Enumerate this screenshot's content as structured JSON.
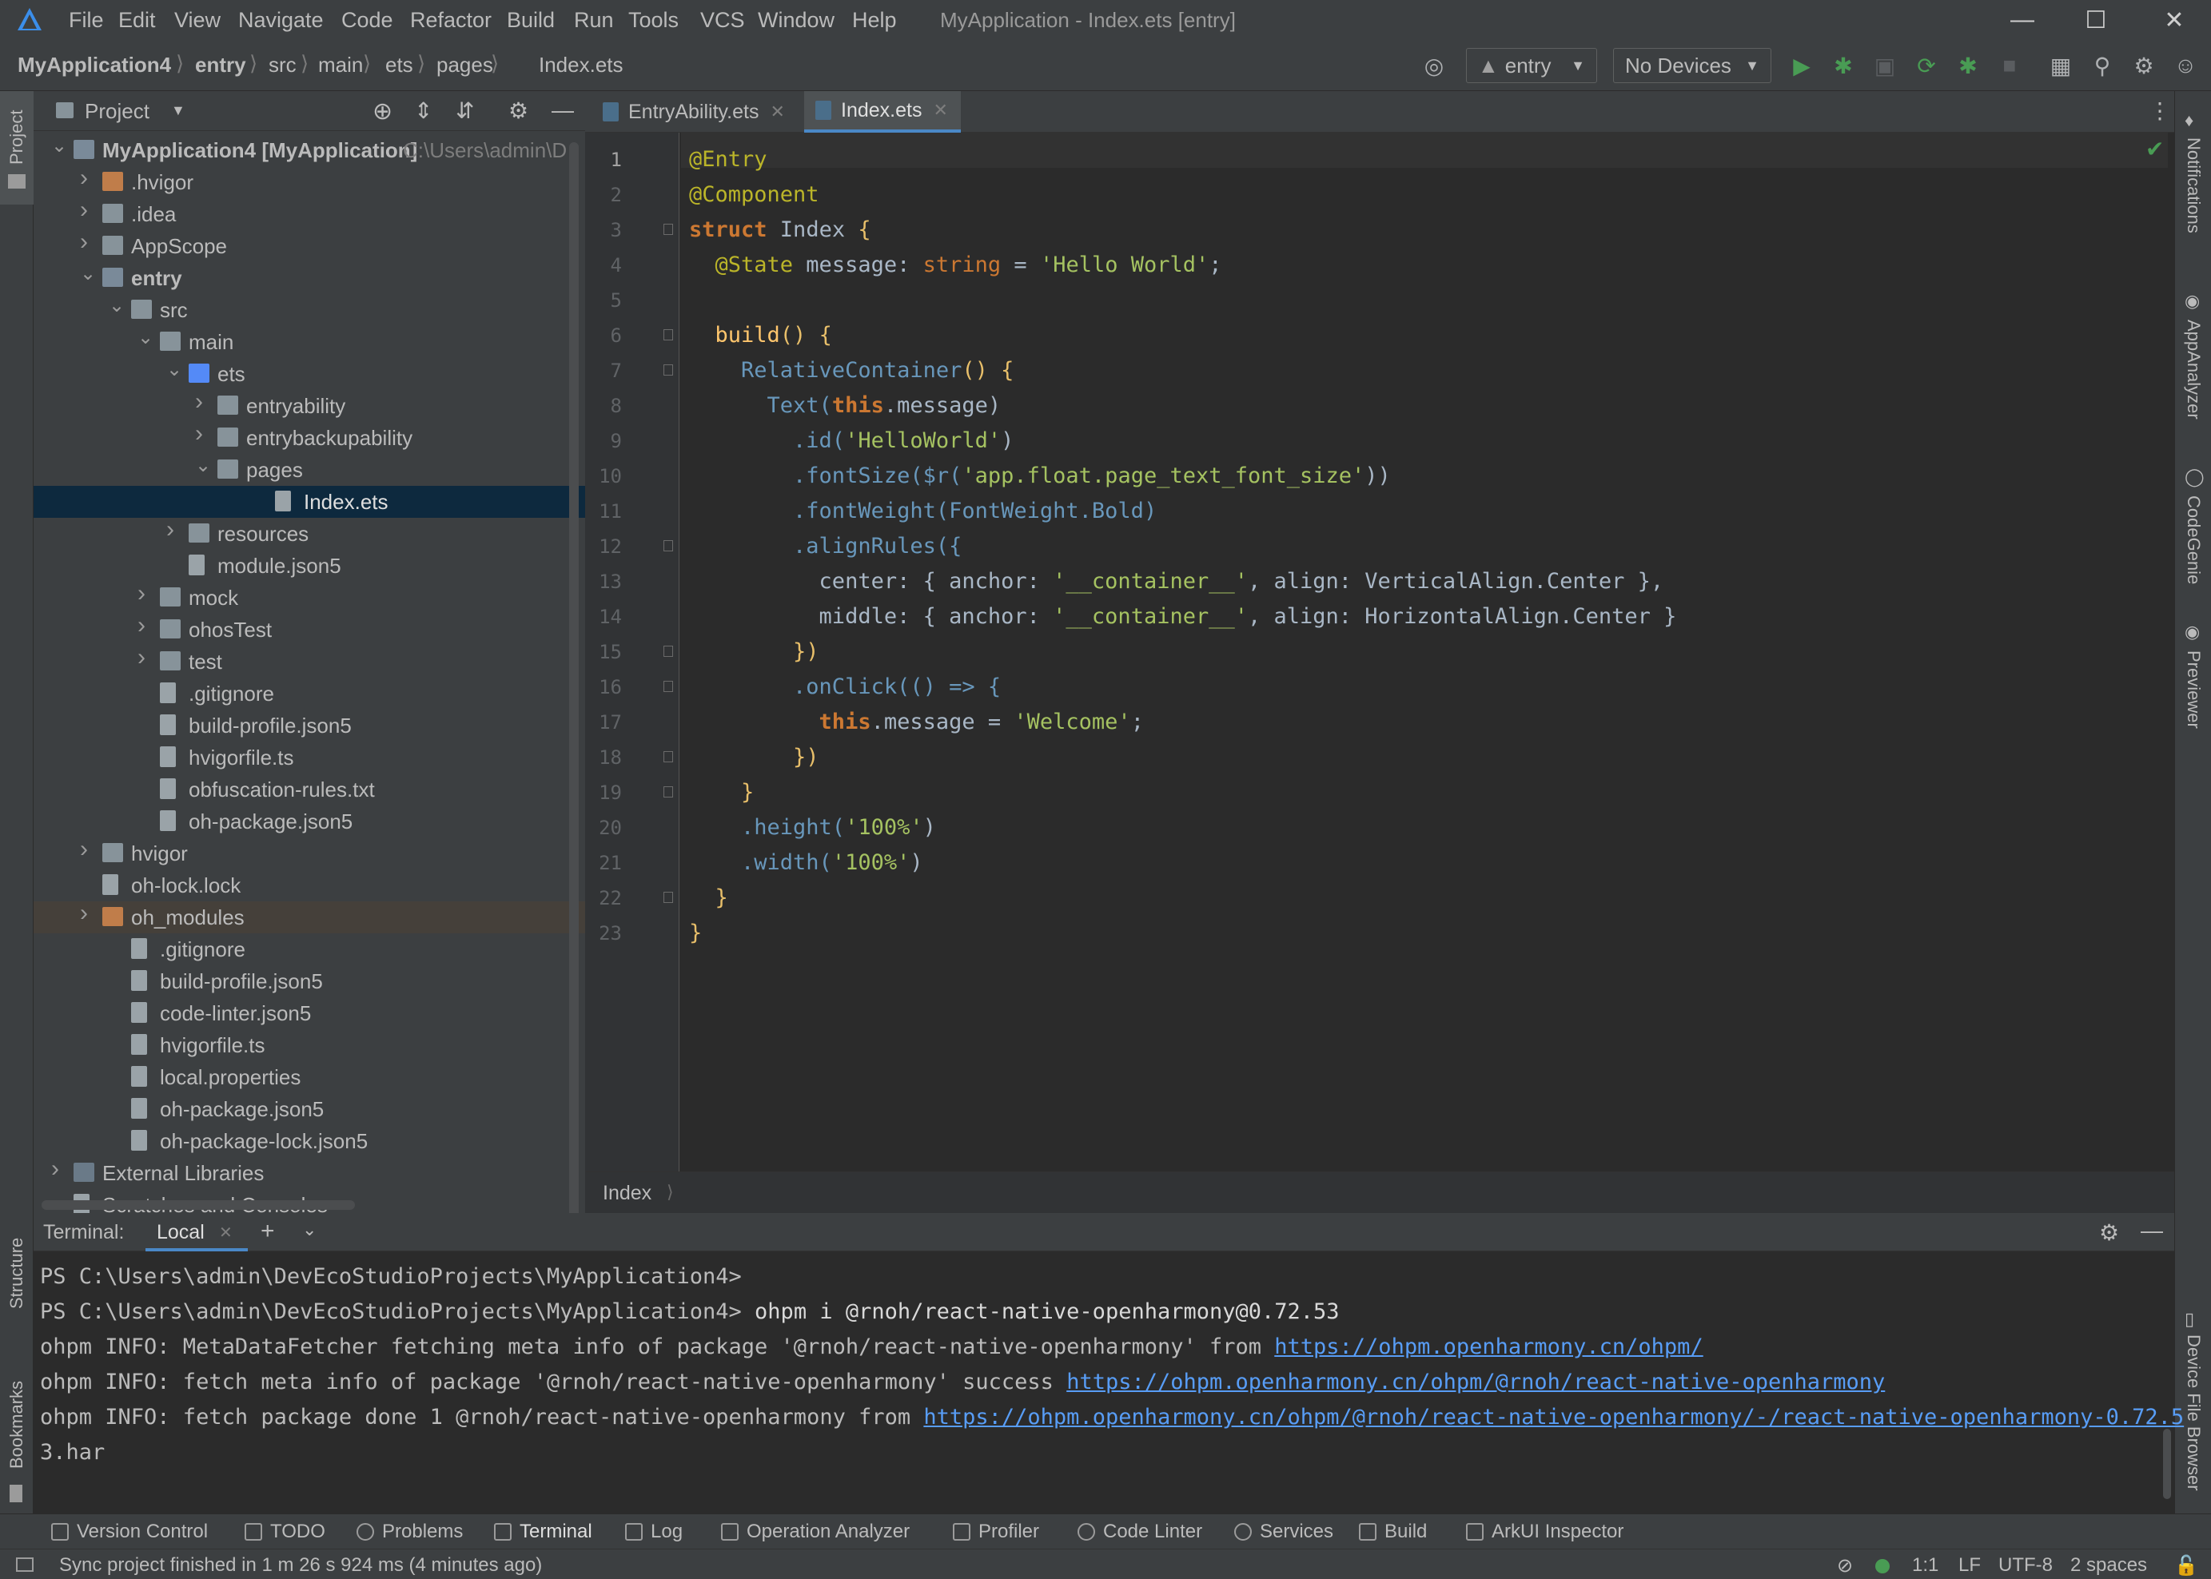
{
  "window": {
    "title": "MyApplication - Index.ets [entry]",
    "menu": [
      "File",
      "Edit",
      "View",
      "Navigate",
      "Code",
      "Refactor",
      "Build",
      "Run",
      "Tools",
      "VCS",
      "Window",
      "Help"
    ]
  },
  "breadcrumb": [
    "MyApplication4",
    "entry",
    "src",
    "main",
    "ets",
    "pages",
    "Index.ets"
  ],
  "toolbar": {
    "module": "entry",
    "device": "No Devices"
  },
  "project_panel": {
    "title": "Project",
    "tree": [
      {
        "label": "MyApplication4 [MyApplication]",
        "extra": "C:\\Users\\admin\\D"
      },
      {
        "label": ".hvigor"
      },
      {
        "label": ".idea"
      },
      {
        "label": "AppScope"
      },
      {
        "label": "entry"
      },
      {
        "label": "src"
      },
      {
        "label": "main"
      },
      {
        "label": "ets"
      },
      {
        "label": "entryability"
      },
      {
        "label": "entrybackupability"
      },
      {
        "label": "pages"
      },
      {
        "label": "Index.ets"
      },
      {
        "label": "resources"
      },
      {
        "label": "module.json5"
      },
      {
        "label": "mock"
      },
      {
        "label": "ohosTest"
      },
      {
        "label": "test"
      },
      {
        "label": ".gitignore"
      },
      {
        "label": "build-profile.json5"
      },
      {
        "label": "hvigorfile.ts"
      },
      {
        "label": "obfuscation-rules.txt"
      },
      {
        "label": "oh-package.json5"
      },
      {
        "label": "hvigor"
      },
      {
        "label": "oh-lock.lock"
      },
      {
        "label": "oh_modules"
      },
      {
        "label": ".gitignore"
      },
      {
        "label": "build-profile.json5"
      },
      {
        "label": "code-linter.json5"
      },
      {
        "label": "hvigorfile.ts"
      },
      {
        "label": "local.properties"
      },
      {
        "label": "oh-package.json5"
      },
      {
        "label": "oh-package-lock.json5"
      },
      {
        "label": "External Libraries"
      },
      {
        "label": "Scratches and Consoles"
      }
    ]
  },
  "editor": {
    "tabs": [
      {
        "label": "EntryAbility.ets"
      },
      {
        "label": "Index.ets"
      }
    ],
    "line_numbers": [
      "1",
      "2",
      "3",
      "4",
      "5",
      "6",
      "7",
      "8",
      "9",
      "10",
      "11",
      "12",
      "13",
      "14",
      "15",
      "16",
      "17",
      "18",
      "19",
      "20",
      "21",
      "22",
      "23"
    ],
    "breadcrumb": "Index",
    "code": {
      "l1": "@Entry",
      "l2": "@Component",
      "l3a": "struct",
      "l3b": " Index ",
      "l3c": "{",
      "l4a": "  @State",
      "l4b": " message: ",
      "l4c": "string",
      "l4d": " = ",
      "l4e": "'Hello World'",
      "l4f": ";",
      "l6a": "  build",
      "l6b": "() {",
      "l7a": "    RelativeContainer",
      "l7b": "() {",
      "l8a": "      Text(",
      "l8b": "this",
      "l8c": ".message)",
      "l9a": "        .id(",
      "l9b": "'HelloWorld'",
      "l9c": ")",
      "l10a": "        .fontSize($r(",
      "l10b": "'app.float.page_text_font_size'",
      "l10c": "))",
      "l11": "        .fontWeight(FontWeight.Bold)",
      "l12": "        .alignRules({",
      "l13a": "          center: { anchor: ",
      "l13b": "'__container__'",
      "l13c": ", align: VerticalAlign.Center },",
      "l14a": "          middle: { anchor: ",
      "l14b": "'__container__'",
      "l14c": ", align: HorizontalAlign.Center }",
      "l15": "        })",
      "l16": "        .onClick(() => {",
      "l17a": "          this",
      "l17b": ".message = ",
      "l17c": "'Welcome'",
      "l17d": ";",
      "l18": "        })",
      "l19": "    }",
      "l20a": "    .height(",
      "l20b": "'100%'",
      "l20c": ")",
      "l21a": "    .width(",
      "l21b": "'100%'",
      "l21c": ")",
      "l22": "  }",
      "l23": "}"
    }
  },
  "terminal": {
    "label": "Terminal:",
    "tab": "Local",
    "lines": {
      "l1": "PS C:\\Users\\admin\\DevEcoStudioProjects\\MyApplication4>",
      "l2a": "PS C:\\Users\\admin\\DevEcoStudioProjects\\MyApplication4> ",
      "l2b": "ohpm i @rnoh/react-native-openharmony@0.72.53",
      "l3a": "ohpm INFO: MetaDataFetcher fetching meta info of package '@rnoh/react-native-openharmony' from ",
      "l3b": "https://ohpm.openharmony.cn/ohpm/",
      "l4a": "ohpm INFO: fetch meta info of package '@rnoh/react-native-openharmony' success ",
      "l4b": "https://ohpm.openharmony.cn/ohpm/@rnoh/react-native-openharmony",
      "l5a": "ohpm INFO: fetch package done 1 @rnoh/react-native-openharmony from ",
      "l5b": "https://ohpm.openharmony.cn/ohpm/@rnoh/react-native-openharmony/-/react-native-openharmony-0.72.5",
      "l6": "3.har"
    }
  },
  "side_left": {
    "project": "Project",
    "structure": "Structure",
    "bookmarks": "Bookmarks"
  },
  "side_right": {
    "notifications": "Notifications",
    "appanalyzer": "AppAnalyzer",
    "codegenie": "CodeGenie",
    "previewer": "Previewer",
    "devicefile": "Device File Browser"
  },
  "toolwindows": [
    "Version Control",
    "TODO",
    "Problems",
    "Terminal",
    "Log",
    "Operation Analyzer",
    "Profiler",
    "Code Linter",
    "Services",
    "Build",
    "ArkUI Inspector"
  ],
  "status": {
    "message": "Sync project finished in 1 m 26 s 924 ms (4 minutes ago)",
    "position": "1:1",
    "line_ending": "LF",
    "encoding": "UTF-8",
    "indent": "2 spaces"
  },
  "colors": {
    "accent": "#4a88c7",
    "selection": "#0d293e",
    "link": "#589df6"
  }
}
